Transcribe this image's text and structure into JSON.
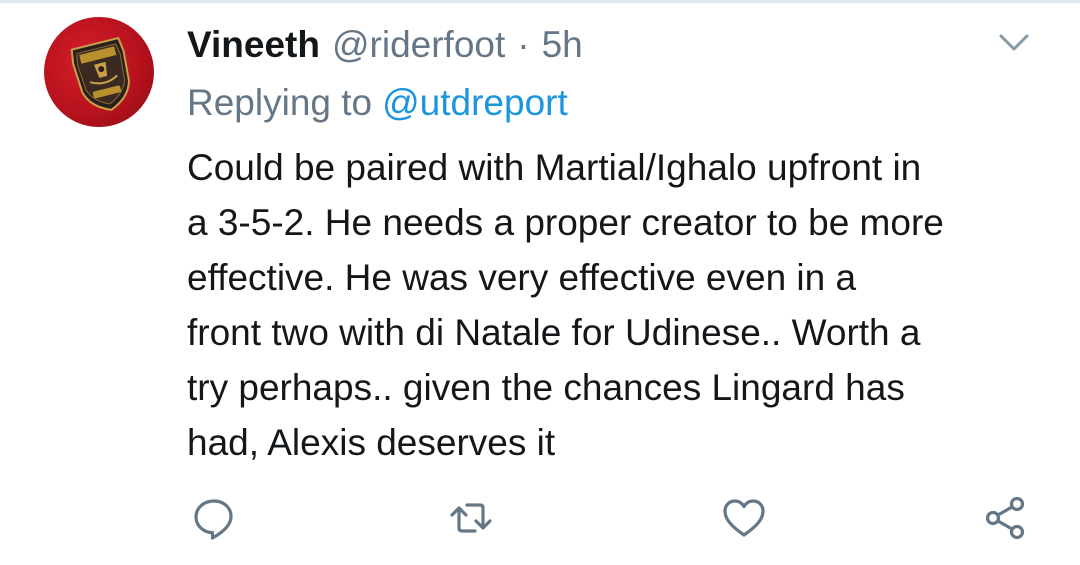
{
  "tweet": {
    "author": {
      "display_name": "Vineeth",
      "handle": "@riderfoot",
      "separator": "·",
      "time": "5h",
      "avatar_icon": "manchester-united-crest"
    },
    "reply": {
      "prefix": "Replying to",
      "target": "@utdreport"
    },
    "body_lines": [
      "Could be paired with Martial/Ighalo upfront in",
      "a 3-5-2. He needs a proper creator to be more",
      "effective. He was very effective even in a",
      "front two with di Natale for Udinese.. Worth a",
      "try perhaps.. given the chances Lingard has",
      "had, Alexis deserves it"
    ],
    "actions": [
      {
        "name": "reply",
        "icon": "comment-icon"
      },
      {
        "name": "retweet",
        "icon": "retweet-icon"
      },
      {
        "name": "like",
        "icon": "heart-icon"
      },
      {
        "name": "share",
        "icon": "share-icon"
      }
    ]
  },
  "colors": {
    "text": "#14171a",
    "secondary": "#657786",
    "link": "#1b95e0",
    "divider": "#e1e8ed",
    "avatar_red": "#c8141f"
  }
}
